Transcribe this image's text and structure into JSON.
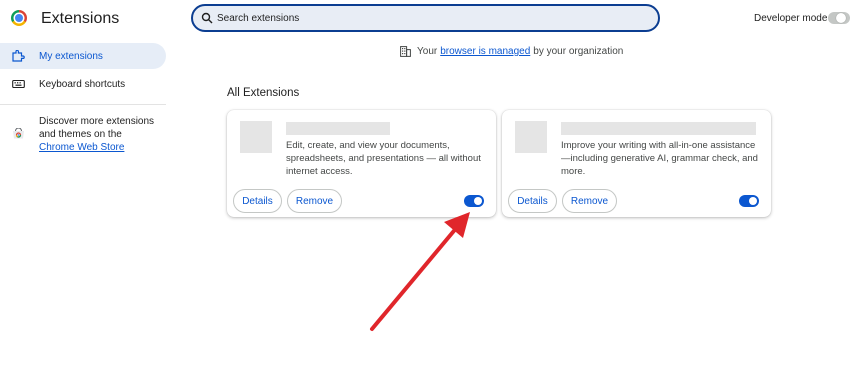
{
  "header": {
    "title": "Extensions",
    "search_placeholder": "Search extensions",
    "developer_mode_label": "Developer mode",
    "developer_mode_enabled": false
  },
  "sidebar": {
    "items": [
      {
        "label": "My extensions",
        "icon": "puzzle-icon",
        "active": true
      },
      {
        "label": "Keyboard shortcuts",
        "icon": "keyboard-icon",
        "active": false
      }
    ],
    "discover_text": "Discover more extensions and themes on the",
    "store_link": "Chrome Web Store",
    "store_icon": "chrome-web-store-icon"
  },
  "managed_notice": {
    "prefix": "Your",
    "link": "browser is managed",
    "suffix": "by your organization",
    "icon": "building-icon"
  },
  "section_title": "All Extensions",
  "extensions": [
    {
      "description": "Edit, create, and view your documents, spreadsheets, and presentations — all without internet access.",
      "details_label": "Details",
      "remove_label": "Remove",
      "enabled": true
    },
    {
      "description": "Improve your writing with all-in-one assistance—including generative AI, grammar check, and more.",
      "details_label": "Details",
      "remove_label": "Remove",
      "enabled": true
    }
  ],
  "colors": {
    "accent": "#0b57d0",
    "annotation_arrow": "#e0262b",
    "sidebar_active_bg": "#e6edf7",
    "search_border": "#0b3d91"
  }
}
